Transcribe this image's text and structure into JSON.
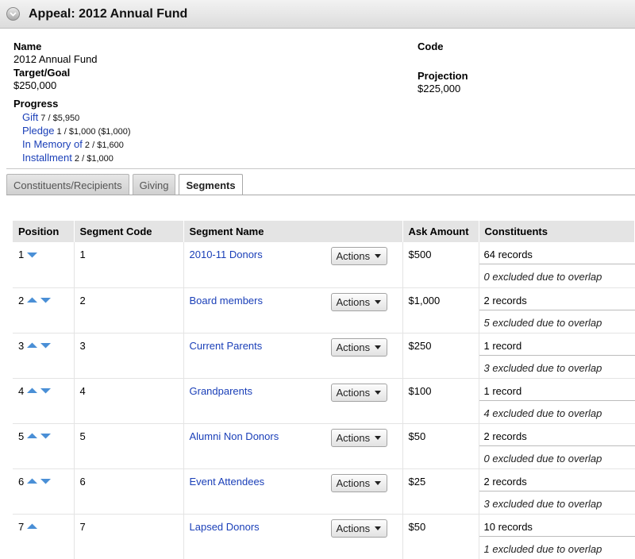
{
  "header": {
    "title": "Appeal: 2012 Annual Fund"
  },
  "details": {
    "name_label": "Name",
    "name_value": "2012 Annual Fund",
    "target_label": "Target/Goal",
    "target_value": "$250,000",
    "code_label": "Code",
    "code_value": "",
    "projection_label": "Projection",
    "projection_value": "$225,000",
    "progress_label": "Progress",
    "progress": [
      {
        "label": "Gift",
        "value": " 7 / $5,950"
      },
      {
        "label": "Pledge",
        "value": " 1 / $1,000 ($1,000)"
      },
      {
        "label": "In Memory of",
        "value": " 2 / $1,600"
      },
      {
        "label": "Installment",
        "value": " 2 / $1,000"
      }
    ]
  },
  "tabs": [
    {
      "label": "Constituents/Recipients",
      "active": false
    },
    {
      "label": "Giving",
      "active": false
    },
    {
      "label": "Segments",
      "active": true
    }
  ],
  "table": {
    "headers": [
      "Position",
      "Segment Code",
      "Segment Name",
      "Ask Amount",
      "Constituents"
    ],
    "actions_label": "Actions",
    "rows": [
      {
        "position": "1",
        "up": false,
        "down": true,
        "code": "1",
        "name": "2010-11 Donors",
        "ask": "$500",
        "records": "64 records",
        "excluded": "0 excluded due to overlap"
      },
      {
        "position": "2",
        "up": true,
        "down": true,
        "code": "2",
        "name": "Board members",
        "ask": "$1,000",
        "records": "2 records",
        "excluded": "5 excluded due to overlap"
      },
      {
        "position": "3",
        "up": true,
        "down": true,
        "code": "3",
        "name": "Current Parents",
        "ask": "$250",
        "records": "1 record",
        "excluded": "3 excluded due to overlap"
      },
      {
        "position": "4",
        "up": true,
        "down": true,
        "code": "4",
        "name": "Grandparents",
        "ask": "$100",
        "records": "1 record",
        "excluded": "4 excluded due to overlap"
      },
      {
        "position": "5",
        "up": true,
        "down": true,
        "code": "5",
        "name": "Alumni Non Donors",
        "ask": "$50",
        "records": "2 records",
        "excluded": "0 excluded due to overlap"
      },
      {
        "position": "6",
        "up": true,
        "down": true,
        "code": "6",
        "name": "Event Attendees",
        "ask": "$25",
        "records": "2 records",
        "excluded": "3 excluded due to overlap"
      },
      {
        "position": "7",
        "up": true,
        "down": false,
        "code": "7",
        "name": "Lapsed Donors",
        "ask": "$50",
        "records": "10 records",
        "excluded": "1 excluded due to overlap"
      }
    ]
  },
  "colors": {
    "link": "#1a3fb8",
    "arrow": "#4a8fd6",
    "header_bg": "#e4e4e4"
  }
}
